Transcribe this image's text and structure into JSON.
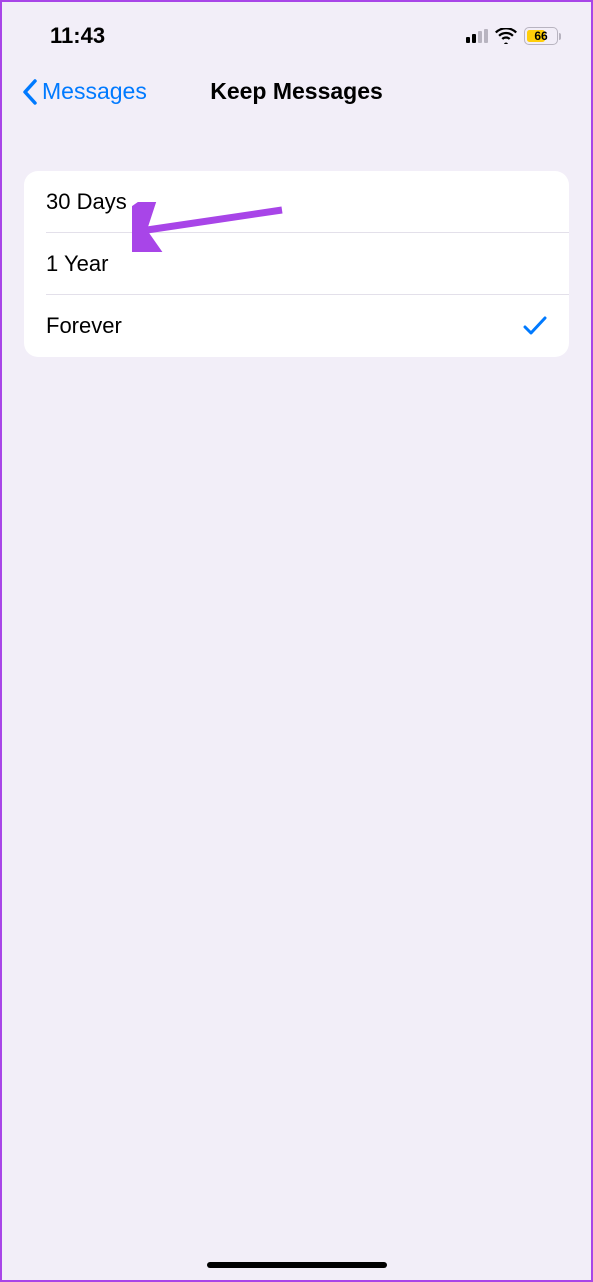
{
  "status": {
    "time": "11:43",
    "battery_level": "66"
  },
  "nav": {
    "back_label": "Messages",
    "title": "Keep Messages"
  },
  "options": [
    {
      "label": "30 Days",
      "selected": false
    },
    {
      "label": "1 Year",
      "selected": false
    },
    {
      "label": "Forever",
      "selected": true
    }
  ]
}
